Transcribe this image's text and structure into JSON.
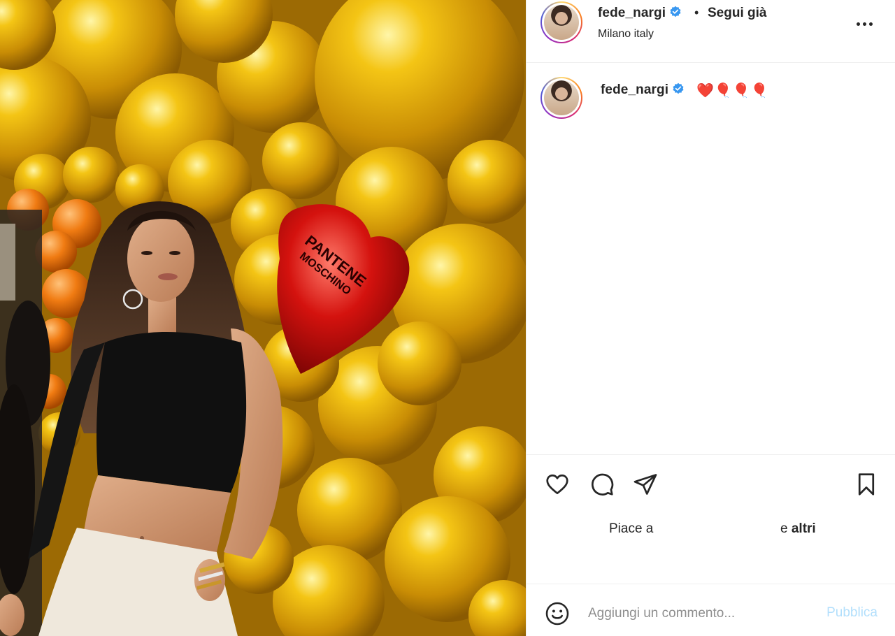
{
  "post": {
    "author": {
      "username": "fede_nargi",
      "verified": true,
      "follow_state": "Segui già",
      "separator": "•",
      "location": "Milano italy"
    },
    "photo": {
      "description_icon": "photo",
      "balloon_text": "PANTENE MOSCHINO"
    },
    "caption": {
      "username": "fede_nargi",
      "text": "❤️🎈🎈🎈"
    },
    "likes": {
      "prefix": "Piace a",
      "suffix_plain": "e",
      "suffix_bold": "altri"
    },
    "comment": {
      "placeholder": "Aggiungi un commento...",
      "publish_label": "Pubblica"
    },
    "colors": {
      "verified_blue": "#3897f0",
      "publish_disabled": "#b2dffc",
      "text": "#262626",
      "muted": "#8e8e8e",
      "heart_red": "#e0201e"
    },
    "icons": [
      "more-icon",
      "heart-icon",
      "comment-icon",
      "share-icon",
      "bookmark-icon",
      "emoji-icon",
      "verified-icon"
    ]
  }
}
